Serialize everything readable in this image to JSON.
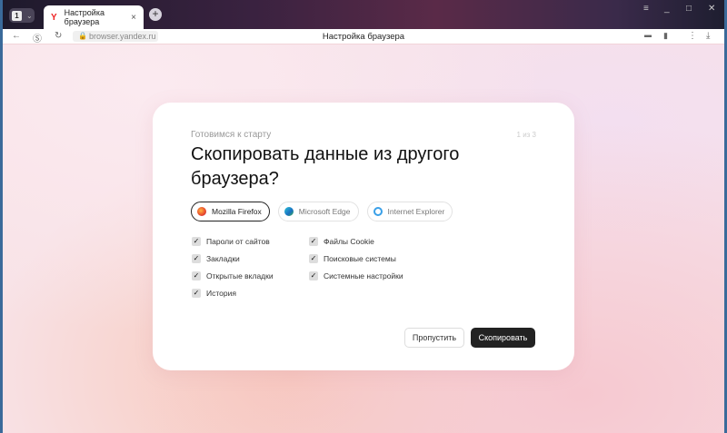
{
  "tabbar": {
    "tab_count": "1",
    "tab_title": "Настройка браузера",
    "favicon": "Y"
  },
  "address": {
    "url": "browser.yandex.ru",
    "page_title": "Настройка браузера"
  },
  "card": {
    "subtitle": "Готовимся к старту",
    "step": "1 из 3",
    "title": "Скопировать данные из другого браузера?",
    "browsers": [
      {
        "label": "Mozilla Firefox",
        "selected": true
      },
      {
        "label": "Microsoft Edge",
        "selected": false
      },
      {
        "label": "Internet Explorer",
        "selected": false
      }
    ],
    "options": [
      "Пароли от сайтов",
      "Закладки",
      "Открытые вкладки",
      "История",
      "Файлы Cookie",
      "Поисковые системы",
      "Системные настройки"
    ],
    "skip_label": "Пропустить",
    "copy_label": "Скопировать"
  }
}
